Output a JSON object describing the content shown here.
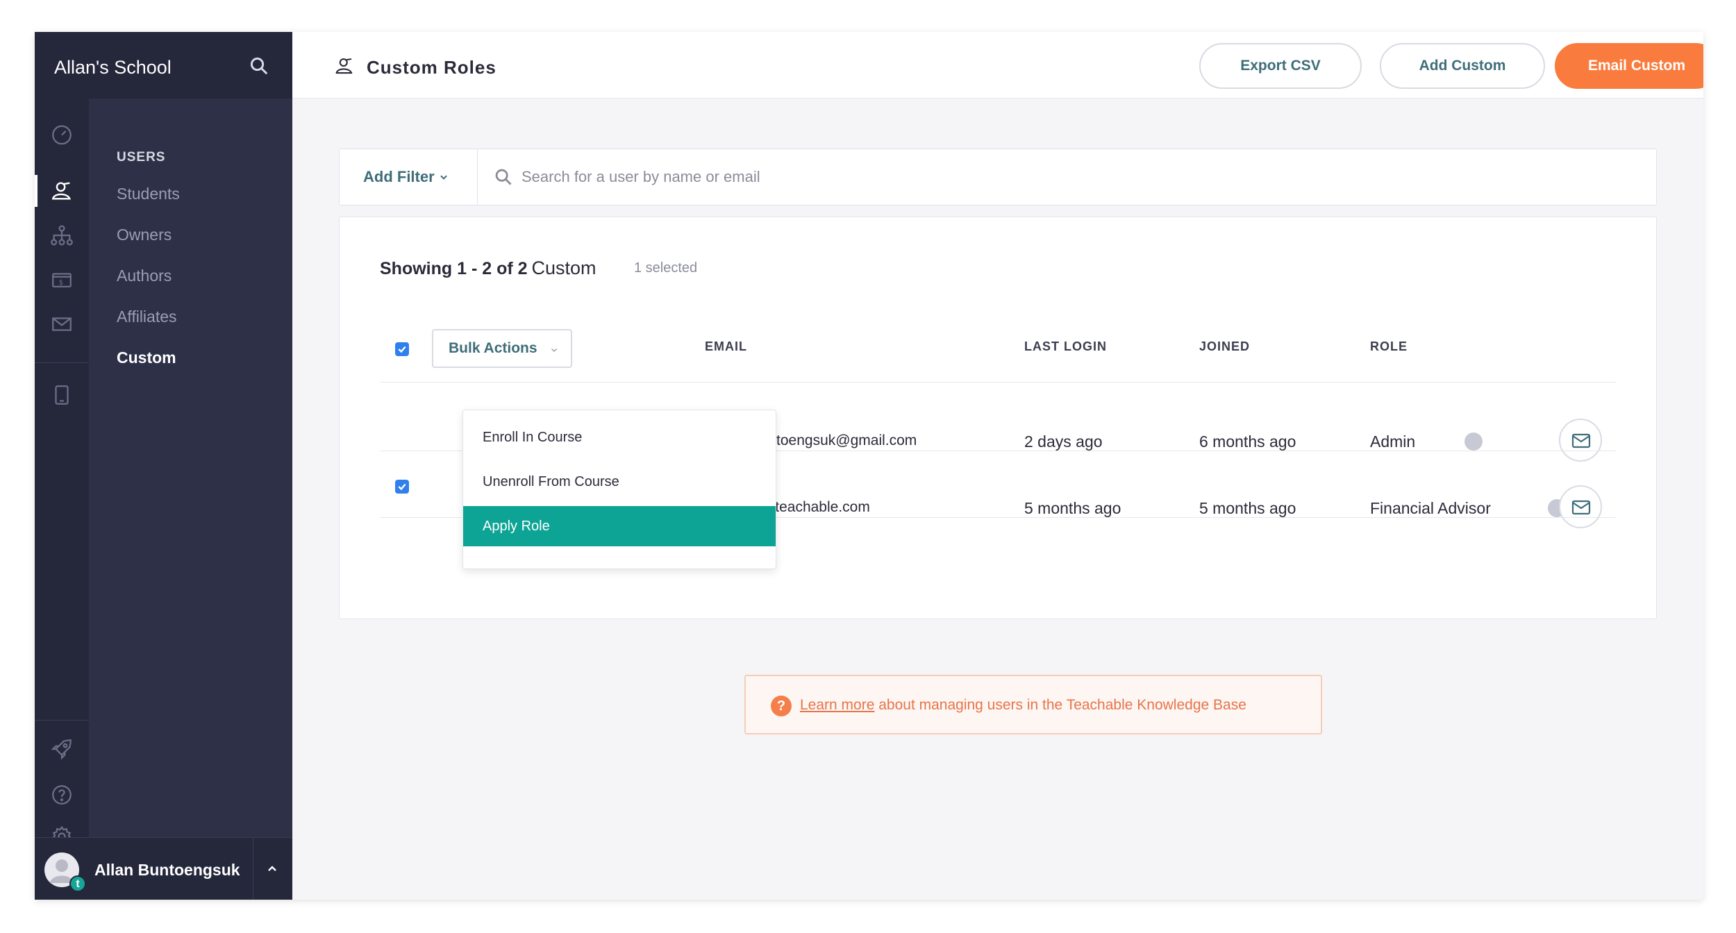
{
  "sidebar": {
    "school_name": "Allan's School",
    "section_heading": "USERS",
    "items": [
      {
        "label": "Students"
      },
      {
        "label": "Owners"
      },
      {
        "label": "Authors"
      },
      {
        "label": "Affiliates"
      },
      {
        "label": "Custom",
        "active": true
      }
    ],
    "rail_icons": [
      "dashboard-icon",
      "users-icon",
      "sitemap-icon",
      "sales-icon",
      "email-icon",
      "tablet-icon",
      "rocket-icon",
      "help-icon",
      "settings-icon"
    ],
    "user_name": "Allan Buntoengsuk",
    "avatar_badge": "t"
  },
  "header": {
    "title": "Custom Roles",
    "export_button": "Export CSV",
    "add_button": "Add Custom",
    "email_button": "Email Custom"
  },
  "filter": {
    "add_filter_label": "Add Filter",
    "search_placeholder": "Search for a user by name or email"
  },
  "results": {
    "showing": "Showing 1 - 2 of 2",
    "role": "Custom",
    "selected": "1 selected"
  },
  "table": {
    "bulk_actions_label": "Bulk Actions",
    "columns": [
      "EMAIL",
      "LAST LOGIN",
      "JOINED",
      "ROLE"
    ],
    "rows": [
      {
        "email": "buntoengsuk@gmail.com",
        "last_login": "2 days ago",
        "joined": "6 months ago",
        "role": "Admin",
        "checked": false
      },
      {
        "email": "+2@teachable.com",
        "last_login": "5 months ago",
        "joined": "5 months ago",
        "role": "Financial Advisor",
        "checked": true
      }
    ]
  },
  "bulk_menu": {
    "items": [
      "Enroll In Course",
      "Unenroll From Course",
      "Apply Role"
    ],
    "highlighted": "Apply Role"
  },
  "info": {
    "link_text": "Learn more",
    "text": " about managing users in the Teachable Knowledge Base"
  },
  "colors": {
    "sidebar": "#2e3048",
    "accent_orange": "#f97c3e",
    "teal": "#0ea495",
    "checkbox_blue": "#2f80ed"
  }
}
